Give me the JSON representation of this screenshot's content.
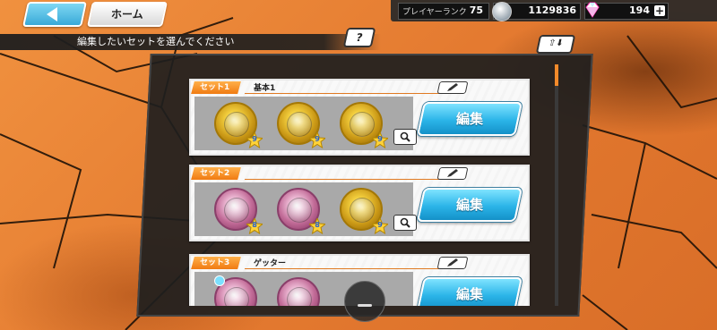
{
  "header": {
    "home_label": "ホーム",
    "player_rank_label": "プレイヤーランク",
    "player_rank_value": "75",
    "coins": "1129836",
    "gems": "194",
    "plus_label": "+"
  },
  "instruction": {
    "text": "編集したいセットを選んでください",
    "help_label": "?"
  },
  "sets": [
    {
      "tag": "セット1",
      "name": "基本1",
      "medals": [
        {
          "color": "gold",
          "level": "9"
        },
        {
          "color": "gold",
          "level": "9"
        },
        {
          "color": "gold",
          "level": "9"
        }
      ],
      "edit_label": "編集"
    },
    {
      "tag": "セット2",
      "name": "",
      "medals": [
        {
          "color": "pink",
          "level": "8"
        },
        {
          "color": "pink",
          "level": "8"
        },
        {
          "color": "gold",
          "level": "9"
        }
      ],
      "edit_label": "編集"
    },
    {
      "tag": "セット3",
      "name": "ゲッター",
      "medals": [
        {
          "color": "pink",
          "level": ""
        },
        {
          "color": "pink",
          "level": ""
        }
      ],
      "edit_label": "編集"
    }
  ],
  "colors": {
    "background": "#e8823a",
    "accent_orange": "#f07b12",
    "edit_blue": "#2bb4e8"
  }
}
